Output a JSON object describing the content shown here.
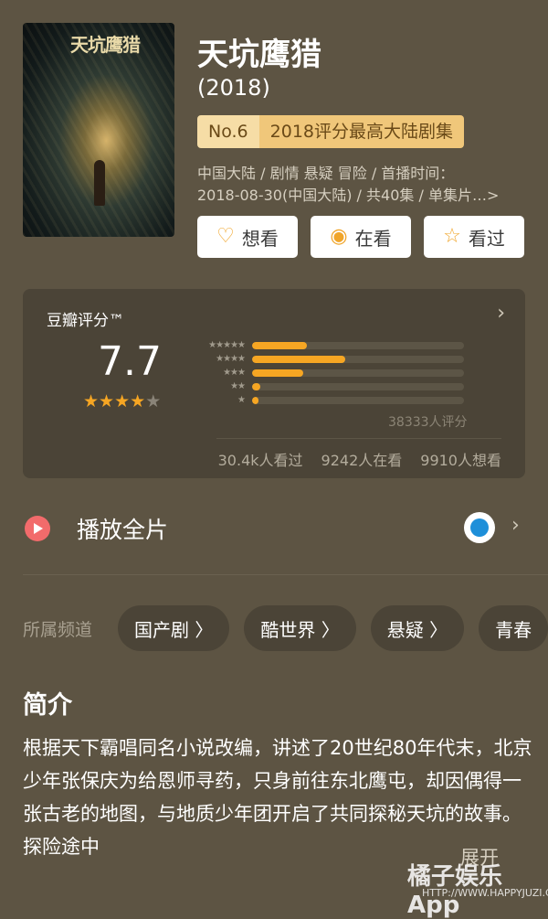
{
  "poster": {
    "title_text": "天坑鹰猎"
  },
  "title": "天坑鹰猎",
  "year": "(2018)",
  "rank": {
    "no": "No.6",
    "text": "2018评分最高大陆剧集"
  },
  "meta": {
    "line1": "中国大陆 / 剧情 悬疑 冒险 / 首播时间：",
    "line2": "2018-08-30(中国大陆) / 共40集 / 单集片…>"
  },
  "actions": [
    {
      "label": "想看",
      "icon": "add-heart-icon"
    },
    {
      "label": "在看",
      "icon": "target-icon"
    },
    {
      "label": "看过",
      "icon": "star-icon"
    }
  ],
  "rating": {
    "label": "豆瓣评分™",
    "score": "7.7",
    "stars_full": 4,
    "stars_total": 5,
    "distribution": [
      {
        "stars": "★★★★★",
        "fraction": 0.26
      },
      {
        "stars": "★★★★",
        "fraction": 0.44
      },
      {
        "stars": "★★★",
        "fraction": 0.24
      },
      {
        "stars": "★★",
        "fraction": 0.04
      },
      {
        "stars": "★",
        "fraction": 0.03
      }
    ],
    "count": "38333人评分",
    "watched": "30.4k人看过",
    "watching": "9242人在看",
    "want": "9910人想看"
  },
  "play": {
    "label": "播放全片",
    "provider_icon": "youku-icon"
  },
  "channels": {
    "label": "所属频道",
    "items": [
      "国产剧 〉",
      "酷世界 〉",
      "悬疑 〉",
      "青春"
    ]
  },
  "intro": {
    "heading": "简介",
    "text": "根据天下霸唱同名小说改编，讲述了20世纪80年代末，北京少年张保庆为给恩师寻药，只身前往东北鹰屯，却因偶得一张古老的地图，与地质少年团开启了共同探秘天坑的故事。探险途中",
    "expand": "展开"
  },
  "watermark": {
    "text": "橘子娱乐App",
    "url": "HTTP://WWW.HAPPYJUZI.COM"
  },
  "colors": {
    "background": "#5d5443",
    "accent": "#f6a623",
    "card": "#4b4437"
  }
}
